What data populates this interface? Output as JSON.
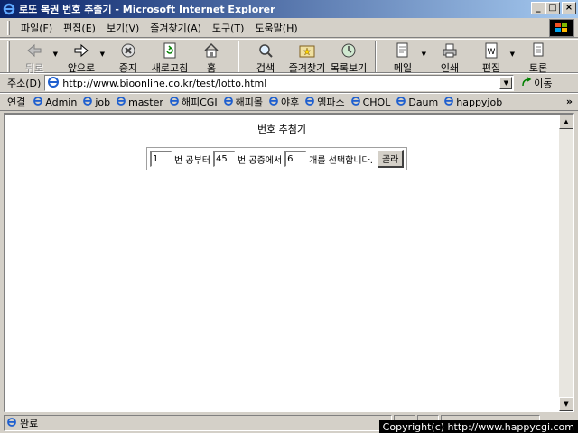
{
  "window": {
    "title": "로또 복권 번호 추출기 - Microsoft Internet Explorer",
    "controls": {
      "minimize": "_",
      "maximize": "□",
      "close": "×"
    }
  },
  "menu": [
    "파일(F)",
    "편집(E)",
    "보기(V)",
    "즐겨찾기(A)",
    "도구(T)",
    "도움말(H)"
  ],
  "toolbar": {
    "back": "뒤로",
    "forward": "앞으로",
    "stop": "중지",
    "refresh": "새로고침",
    "home": "홈",
    "search": "검색",
    "favorites": "즐겨찾기",
    "history": "목록보기",
    "mail": "메일",
    "print": "인쇄",
    "edit": "편집",
    "discuss": "토론"
  },
  "address": {
    "label": "주소(D)",
    "url": "http://www.bioonline.co.kr/test/lotto.html",
    "go": "이동"
  },
  "links": {
    "label": "연결",
    "items": [
      "Admin",
      "job",
      "master",
      "해피CGI",
      "해피몰",
      "야후",
      "엠파스",
      "CHOL",
      "Daum",
      "happyjob"
    ],
    "more": "»"
  },
  "page": {
    "heading": "번호 추첨기",
    "form": {
      "start_value": "1",
      "text_from": "번 공부터",
      "end_value": "45",
      "text_among": "번 공중에서",
      "count_value": "6",
      "text_select": "개를 선택합니다.",
      "button": "골라"
    }
  },
  "status": {
    "text": "완료"
  },
  "watermark": "Copyright(c) http://www.happycgi.com"
}
